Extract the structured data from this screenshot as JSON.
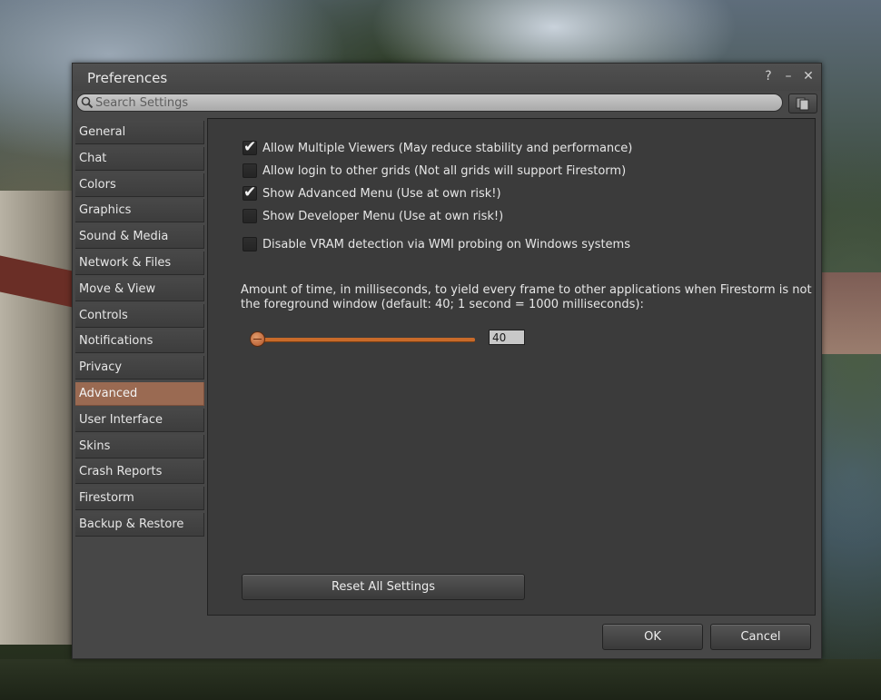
{
  "window": {
    "title": "Preferences"
  },
  "search": {
    "placeholder": "Search Settings"
  },
  "tabs": [
    {
      "label": "General"
    },
    {
      "label": "Chat"
    },
    {
      "label": "Colors"
    },
    {
      "label": "Graphics"
    },
    {
      "label": "Sound & Media"
    },
    {
      "label": "Network & Files"
    },
    {
      "label": "Move & View"
    },
    {
      "label": "Controls"
    },
    {
      "label": "Notifications"
    },
    {
      "label": "Privacy"
    },
    {
      "label": "Advanced",
      "active": true
    },
    {
      "label": "User Interface"
    },
    {
      "label": "Skins"
    },
    {
      "label": "Crash Reports"
    },
    {
      "label": "Firestorm"
    },
    {
      "label": "Backup & Restore"
    }
  ],
  "options": [
    {
      "label": "Allow Multiple Viewers (May reduce stability and performance)",
      "checked": true
    },
    {
      "label": "Allow login to other grids (Not all grids will support Firestorm)",
      "checked": false
    },
    {
      "label": "Show Advanced Menu (Use at own risk!)",
      "checked": true
    },
    {
      "label": "Show Developer Menu (Use at own risk!)",
      "checked": false
    },
    {
      "label": "Disable VRAM detection via WMI probing on Windows systems",
      "checked": false
    }
  ],
  "yield": {
    "description": "Amount of time, in milliseconds, to yield every frame to other applications when Firestorm is not the foreground window (default: 40; 1 second = 1000 milliseconds):",
    "value": "40"
  },
  "buttons": {
    "reset": "Reset All Settings",
    "ok": "OK",
    "cancel": "Cancel"
  },
  "icons": {
    "help": "?",
    "minimize": "–",
    "close": "✕",
    "check": "✔"
  }
}
